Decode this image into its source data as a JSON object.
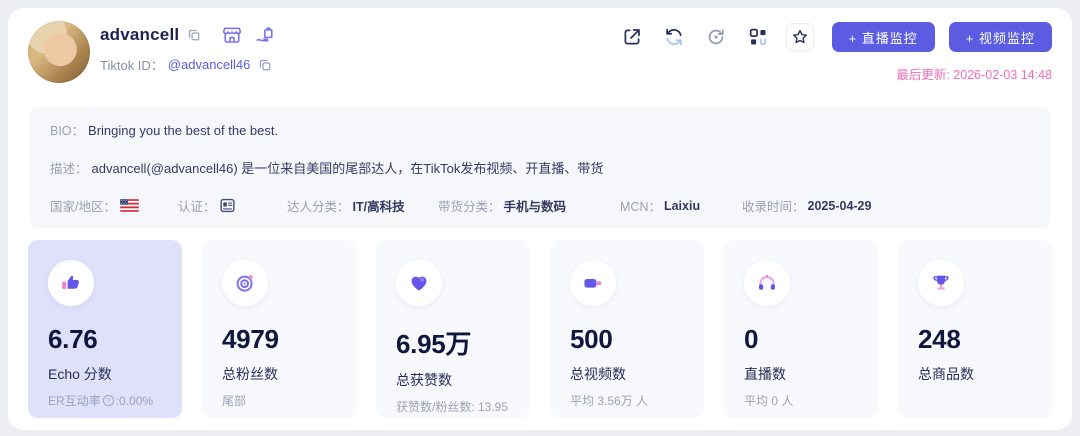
{
  "colors": {
    "accent": "#5b5ce2",
    "pink": "#ee6fb7",
    "dark_navy": "#10173f",
    "highlight_card": "#dfe1fa"
  },
  "header": {
    "name": "advancell",
    "tiktok_id_label": "Tiktok ID：",
    "tiktok_id": "@advancell46",
    "badges": [
      "shop-icon",
      "bag-in-hand-icon"
    ],
    "toolbar": [
      "open-external-icon",
      "refresh-icon",
      "history-icon",
      "components-icon",
      "favorite-star-icon"
    ],
    "live_monitor_button": "+ 直播监控",
    "video_monitor_button": "+ 视频监控",
    "last_update": "最后更新: 2026-02-03 14:48"
  },
  "profile": {
    "bio_label": "BIO：",
    "bio": "Bringing you the best of the best.",
    "desc_label": "描述：",
    "desc": "advancell(@advancell46) 是一位来自美国的尾部达人，在TikTok发布视频、开直播、带货",
    "meta": [
      {
        "label": "国家/地区：",
        "value": "",
        "icon": "us-flag-icon"
      },
      {
        "label": "认证：",
        "value": "",
        "icon": "id-badge-icon"
      },
      {
        "label": "达人分类：",
        "value": "IT/高科技"
      },
      {
        "label": "带货分类：",
        "value": "手机与数码"
      },
      {
        "label": "MCN：",
        "value": "Laixiu"
      },
      {
        "label": "收录时间：",
        "value": "2025-04-29"
      }
    ]
  },
  "stats": [
    {
      "icon": "thumbs-up-icon",
      "value": "6.76",
      "label": "Echo 分数",
      "sub_parts": [
        "ER互动率",
        ":0.00%"
      ],
      "sub_help": true,
      "highlight": true
    },
    {
      "icon": "target-icon",
      "value": "4979",
      "label": "总粉丝数",
      "sub_parts": [
        "尾部"
      ],
      "sub_help": false,
      "highlight": false
    },
    {
      "icon": "heart-icon",
      "value": "6.95万",
      "label": "总获赞数",
      "sub_parts": [
        "获赞数/粉丝数: 13.95"
      ],
      "sub_help": false,
      "highlight": false
    },
    {
      "icon": "video-camera-icon",
      "value": "500",
      "label": "总视频数",
      "sub_parts": [
        "平均 3.56万 人"
      ],
      "sub_help": false,
      "highlight": false
    },
    {
      "icon": "live-headphones-icon",
      "value": "0",
      "label": "直播数",
      "sub_parts": [
        "平均 0 人"
      ],
      "sub_help": false,
      "highlight": false
    },
    {
      "icon": "trophy-icon",
      "value": "248",
      "label": "总商品数",
      "sub_parts": [],
      "sub_help": false,
      "highlight": false
    }
  ]
}
